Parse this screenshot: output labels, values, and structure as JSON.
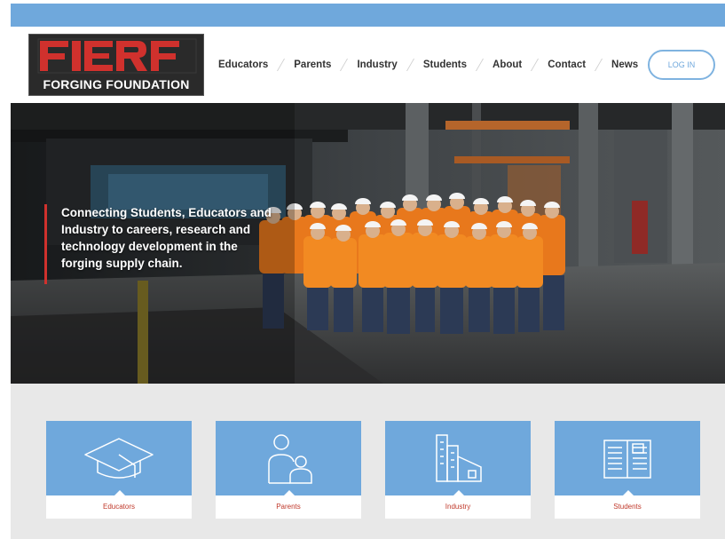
{
  "brand": {
    "logo_top": "FIERF",
    "logo_bottom": "FORGING FOUNDATION"
  },
  "nav": {
    "items": [
      "Educators",
      "Parents",
      "Industry",
      "Students",
      "About",
      "Contact",
      "News"
    ],
    "login_label": "LOG IN"
  },
  "hero": {
    "tagline": "Connecting Students, Educators and Industry to careers, research and technology development in the forging supply chain."
  },
  "cards": [
    {
      "label": "Educators",
      "icon": "graduation-cap-icon"
    },
    {
      "label": "Parents",
      "icon": "parent-child-icon"
    },
    {
      "label": "Industry",
      "icon": "buildings-icon"
    },
    {
      "label": "Students",
      "icon": "open-book-icon"
    }
  ],
  "colors": {
    "accent_blue": "#6fa8dc",
    "logo_red": "#d0312d",
    "hero_rule_red": "#d0312d",
    "card_label_red": "#c0392b",
    "band_gray": "#e8e8e8"
  }
}
